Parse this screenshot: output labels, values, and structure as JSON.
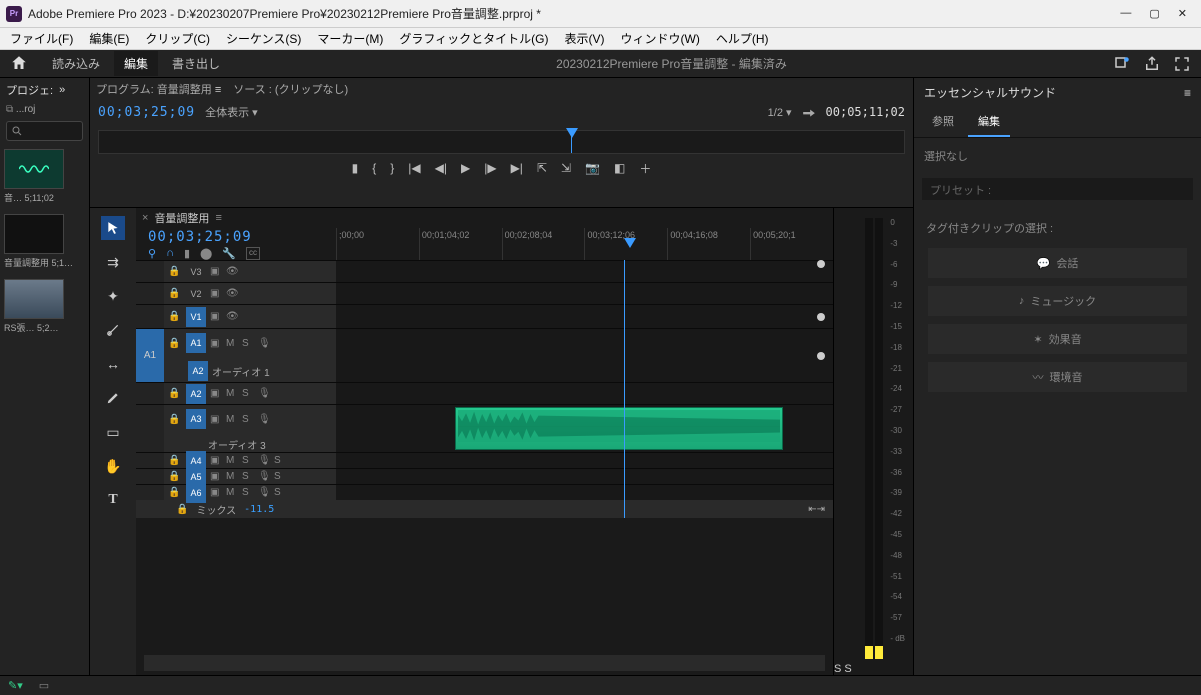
{
  "window": {
    "title": "Adobe Premiere Pro 2023 - D:¥20230207Premiere Pro¥20230212Premiere Pro音量調整.prproj *",
    "app_badge": "Pr"
  },
  "menu": {
    "file": "ファイル(F)",
    "edit": "編集(E)",
    "clip": "クリップ(C)",
    "sequence": "シーケンス(S)",
    "marker": "マーカー(M)",
    "graphics": "グラフィックとタイトル(G)",
    "view": "表示(V)",
    "window": "ウィンドウ(W)",
    "help": "ヘルプ(H)"
  },
  "shelf": {
    "import": "読み込み",
    "edit": "編集",
    "export": "書き出し",
    "project_title": "20230212Premiere Pro音量調整 - 編集済み"
  },
  "project": {
    "panel": "プロジェ:",
    "crumb": "...roj",
    "items": [
      {
        "label": "音… 5;11;02"
      },
      {
        "label": "音量調整用 5;1…"
      },
      {
        "label": "RS張… 5;2…"
      }
    ]
  },
  "program": {
    "panel_label": "プログラム:",
    "panel_seq": "音量調整用",
    "source_label": "ソース : (クリップなし)",
    "timecode_left": "00;03;25;09",
    "fit": "全体表示",
    "zoom": "1/2",
    "timecode_right": "00;05;11;02"
  },
  "timeline": {
    "seq_name": "音量調整用",
    "timecode": "00;03;25;09",
    "ruler": [
      ";00;00",
      "00;01;04;02",
      "00;02;08;04",
      "00;03;12;06",
      "00;04;16;08",
      "00;05;20;1"
    ],
    "video_tracks": [
      {
        "name": "V3"
      },
      {
        "name": "V2"
      },
      {
        "name": "V1"
      }
    ],
    "audio_tracks": [
      {
        "name": "A1",
        "label": "オーディオ 1"
      },
      {
        "name": "A2",
        "label": ""
      },
      {
        "name": "A3",
        "label": "オーディオ 3"
      },
      {
        "name": "A4",
        "label": ""
      },
      {
        "name": "A5",
        "label": ""
      },
      {
        "name": "A6",
        "label": ""
      }
    ],
    "mix_label": "ミックス",
    "mix_db": "-11.5",
    "src_patch": "A1",
    "sync_s": "S"
  },
  "meter": {
    "scale": [
      "0",
      "-3",
      "-6",
      "-9",
      "-12",
      "-15",
      "-18",
      "-21",
      "-24",
      "-27",
      "-30",
      "-33",
      "-36",
      "-39",
      "-42",
      "-45",
      "-48",
      "-51",
      "-54",
      "-57",
      "- dB"
    ],
    "solo": "S"
  },
  "essential_sound": {
    "title": "エッセンシャルサウンド",
    "tab_browse": "参照",
    "tab_edit": "編集",
    "selection": "選択なし",
    "preset_label": "プリセット :",
    "tag_label": "タグ付きクリップの選択 :",
    "tags": {
      "dialogue": "会話",
      "music": "ミュージック",
      "sfx": "効果音",
      "ambience": "環境音"
    }
  }
}
